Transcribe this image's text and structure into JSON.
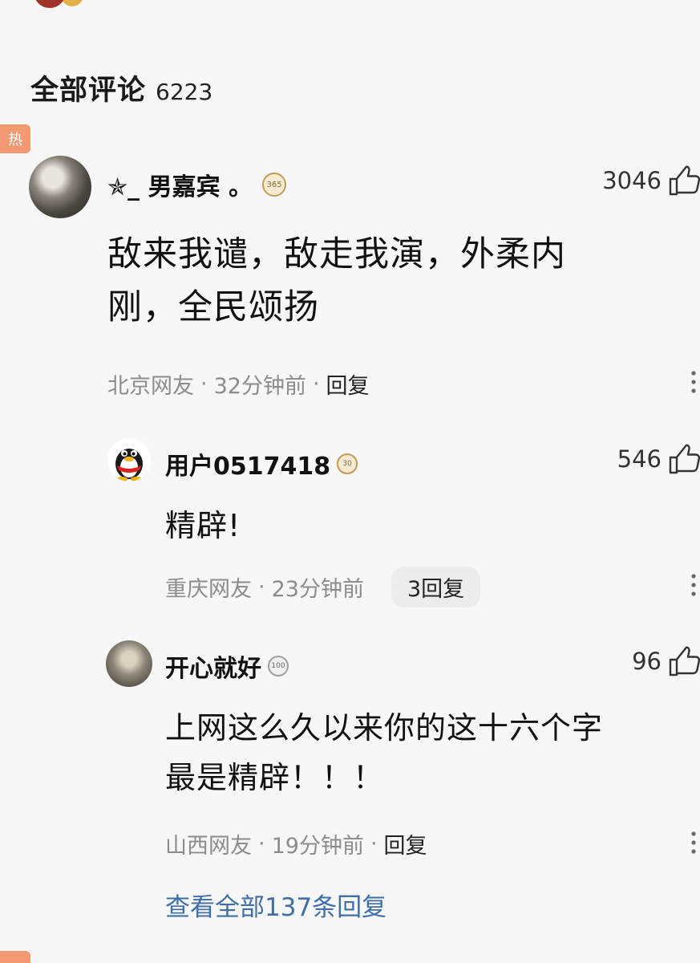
{
  "section": {
    "title": "全部评论",
    "count": "6223"
  },
  "hot_tag": "热",
  "comments": [
    {
      "name": "✯_ 男嘉宾 。",
      "level": "365",
      "likes": "3046",
      "text_lines": [
        "敌来我谴，敌走我演，外柔内",
        "刚，全民颂扬"
      ],
      "location": "北京网友",
      "time": "32分钟前",
      "reply_label": "回复"
    },
    {
      "name": "用户0517418",
      "level": "30",
      "likes": "546",
      "text_lines": [
        "精辟!"
      ],
      "location": "重庆网友",
      "time": "23分钟前",
      "reply_label": "3回复"
    },
    {
      "name": "开心就好",
      "level": "100",
      "likes": "96",
      "text_lines": [
        "上网这么久以来你的这十六个字",
        "最是精辟！！！"
      ],
      "location": "山西网友",
      "time": "19分钟前",
      "reply_label": "回复"
    }
  ],
  "view_all": "查看全部137条回复",
  "separator": "·",
  "colors": {
    "link": "#3e6fa8",
    "hot_tag": "#f39a72",
    "meta": "#8c8c8c"
  },
  "icons": {
    "like": "thumbs-up-icon",
    "more": "more-vertical-icon",
    "level": "level-badge-icon"
  }
}
